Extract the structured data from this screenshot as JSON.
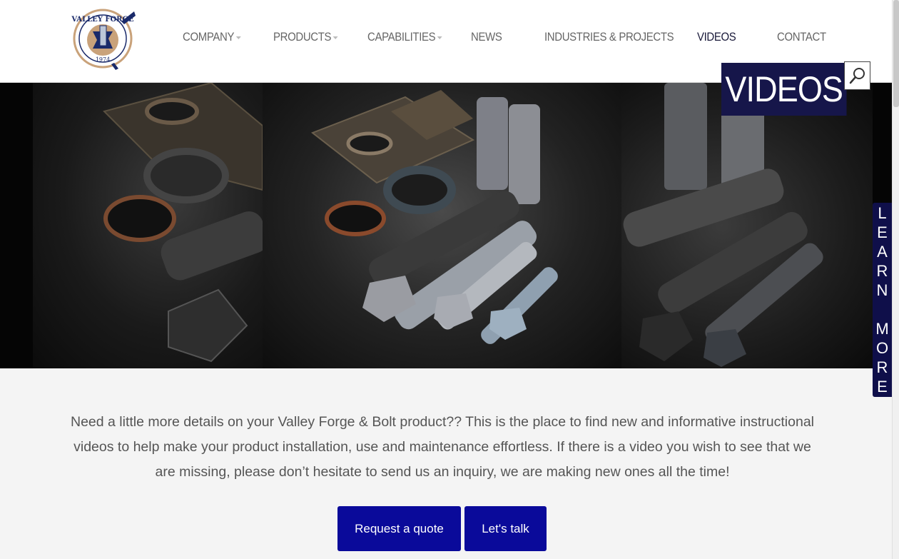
{
  "brand": {
    "logo_text": "VALLEY FORGE",
    "logo_year": "1974",
    "accent": "#16164a",
    "button_color": "#0a0a9a"
  },
  "nav": {
    "items": [
      {
        "label": "COMPANY",
        "dropdown": true
      },
      {
        "label": "PRODUCTS",
        "dropdown": true
      },
      {
        "label": "CAPABILITIES",
        "dropdown": true
      },
      {
        "label": "NEWS",
        "dropdown": false
      },
      {
        "label": "INDUSTRIES & PROJECTS",
        "dropdown": false
      },
      {
        "label": "VIDEOS",
        "dropdown": false,
        "active": true
      },
      {
        "label": "CONTACT",
        "dropdown": false
      }
    ],
    "search_icon": "search-icon"
  },
  "hero": {
    "title": "VIDEOS"
  },
  "side_tab": {
    "label": "LEARN MORE"
  },
  "intro": {
    "text": "Need a little more details on your Valley Forge & Bolt product?? This is the place to find new and informative instructional videos to help make your product installation, use and maintenance effortless. If there is a video you wish to see that we are missing, please don’t hesitate to send us an inquiry, we are making new ones all the time!"
  },
  "cta": {
    "quote_label": "Request a quote",
    "talk_label": "Let's talk"
  }
}
